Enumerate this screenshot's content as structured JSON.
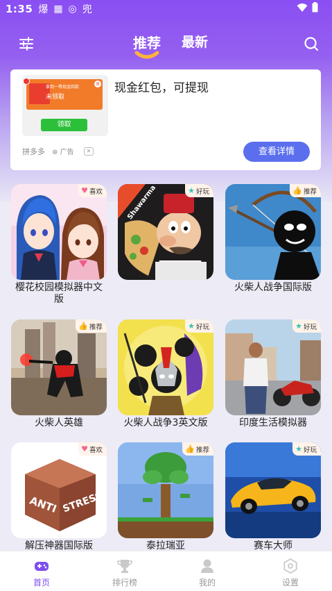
{
  "status": {
    "time": "1:35",
    "icons": [
      "爆",
      "▦",
      "◎",
      "兜"
    ]
  },
  "header": {
    "tabs": [
      {
        "label": "推荐",
        "active": true
      },
      {
        "label": "最新",
        "active": false
      }
    ],
    "filter_icon": "sliders-icon",
    "search_icon": "search-icon"
  },
  "ad": {
    "title": "现金红包，可提现",
    "source": "拼多多",
    "tag": "广告",
    "close": "✕",
    "button": "查看详情",
    "thumb": {
      "line1": "拿到一等现金回款",
      "line2": "未领取",
      "badge": "8",
      "claim": "领取"
    }
  },
  "games": [
    {
      "name": "樱花校园模拟器中文版",
      "tag": "喜欢",
      "tag_icon": "heart-icon"
    },
    {
      "name": "",
      "tag": "好玩",
      "tag_icon": "star-icon",
      "art_text": "Shawarma"
    },
    {
      "name": "火柴人战争国际版",
      "tag": "推荐",
      "tag_icon": "thumbs-up-icon"
    },
    {
      "name": "火柴人英雄",
      "tag": "推荐",
      "tag_icon": "thumbs-up-icon"
    },
    {
      "name": "火柴人战争3英文版",
      "tag": "好玩",
      "tag_icon": "star-icon"
    },
    {
      "name": "印度生活模拟器",
      "tag": "好玩",
      "tag_icon": "star-icon"
    },
    {
      "name": "解压神器国际版",
      "tag": "喜欢",
      "tag_icon": "heart-icon",
      "art_text1": "ANTI",
      "art_text2": "STRESS"
    },
    {
      "name": "泰拉瑞亚",
      "tag": "推荐",
      "tag_icon": "thumbs-up-icon"
    },
    {
      "name": "赛车大师",
      "tag": "好玩",
      "tag_icon": "star-icon"
    }
  ],
  "nav": [
    {
      "label": "首页",
      "icon": "gamepad-icon",
      "active": true
    },
    {
      "label": "排行榜",
      "icon": "trophy-icon",
      "active": false
    },
    {
      "label": "我的",
      "icon": "user-icon",
      "active": false
    },
    {
      "label": "设置",
      "icon": "settings-icon",
      "active": false
    }
  ],
  "colors": {
    "accent": "#7c4df0",
    "header_gradient_top": "#8a4ef2",
    "ad_button": "#5b6fee"
  }
}
